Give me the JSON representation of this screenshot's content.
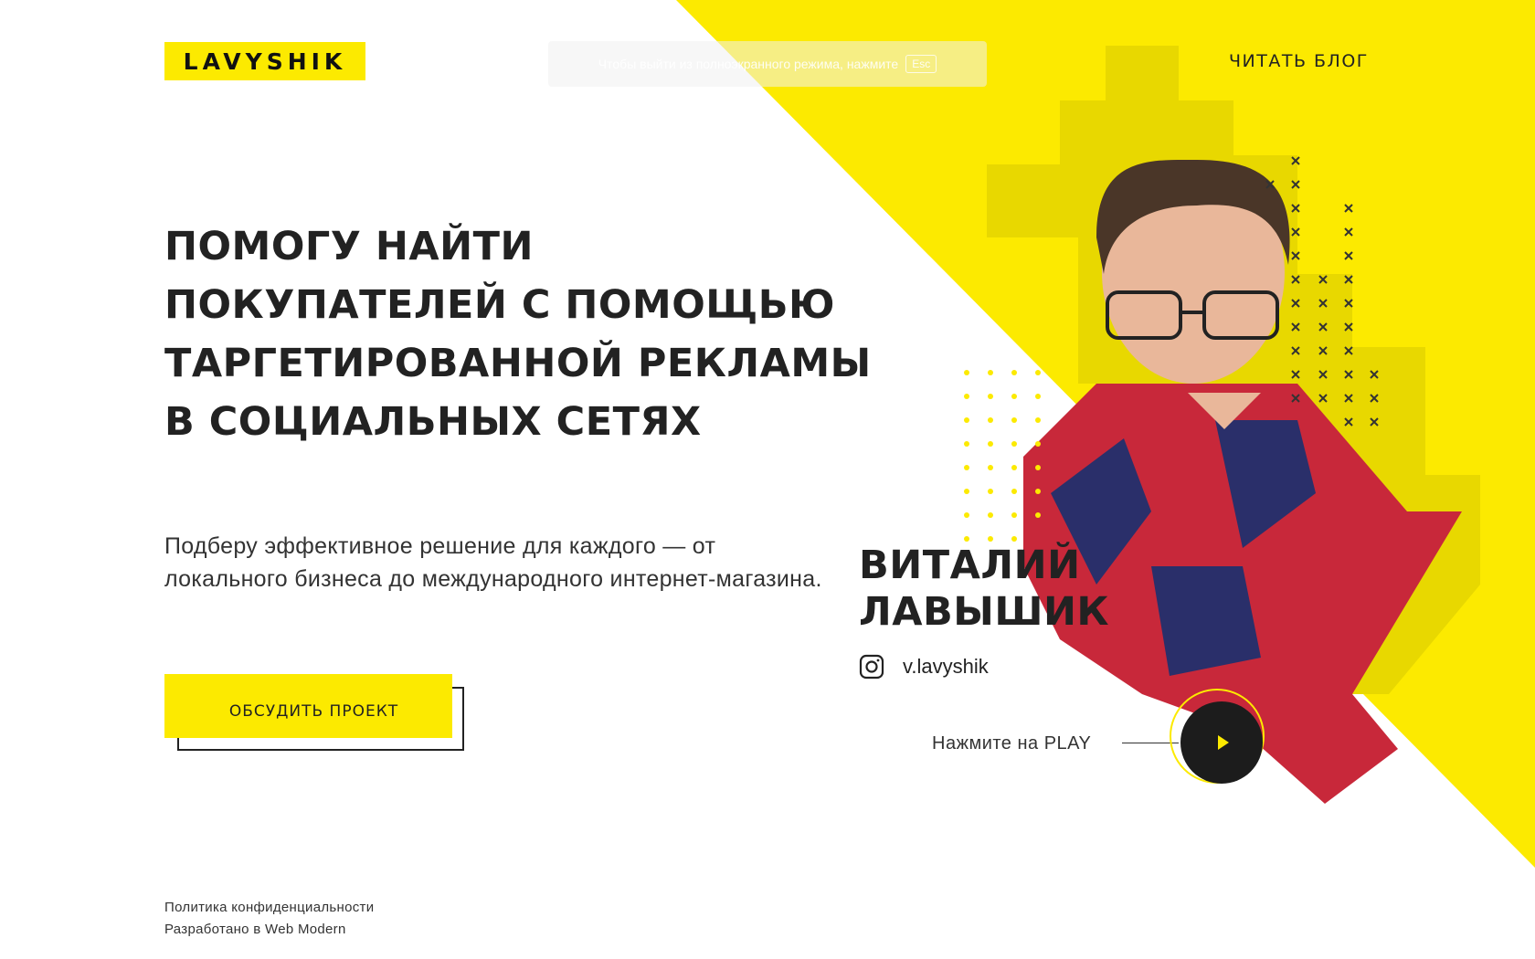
{
  "header": {
    "logo_text": "LAVYSHIK",
    "fullscreen_notice": "Чтобы выйти из полноэкранного режима, нажмите",
    "fullscreen_key": "Esc",
    "blog_link": "ЧИТАТЬ БЛОГ"
  },
  "hero": {
    "title_lines": [
      "ПОМОГУ НАЙТИ",
      "ПОКУПАТЕЛЕЙ С ПОМОЩЬЮ",
      "ТАРГЕТИРОВАННОЙ РЕКЛАМЫ",
      "В СОЦИАЛЬНЫХ СЕТЯХ"
    ],
    "subtitle": "Подберу эффективное решение для каждого — от локального бизнеса до международного интернет-магазина.",
    "cta_label": "ОБСУДИТЬ ПРОЕКТ"
  },
  "person": {
    "first_name": "ВИТАЛИЙ",
    "last_name": "ЛАВЫШИК",
    "instagram_handle": "v.lavyshik",
    "play_label": "Нажмите на PLAY"
  },
  "footer": {
    "privacy_link": "Политика конфиденциальности",
    "credit": "Разработано в Web Modern"
  },
  "colors": {
    "accent": "#fcea00",
    "accent_dark": "#e6d600",
    "text": "#222222",
    "play_bg": "#1c1c1c"
  }
}
